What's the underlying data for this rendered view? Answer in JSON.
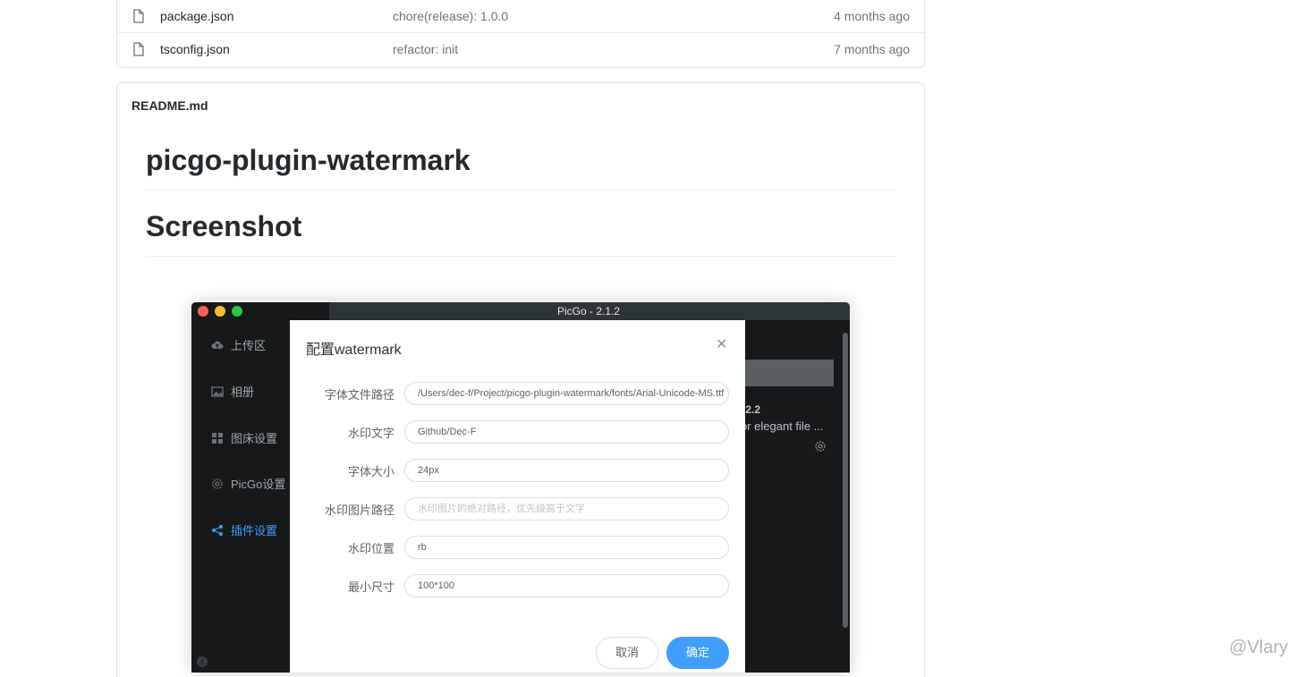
{
  "files": [
    {
      "name": "package.json",
      "message": "chore(release): 1.0.0",
      "age": "4 months ago"
    },
    {
      "name": "tsconfig.json",
      "message": "refactor: init",
      "age": "7 months ago"
    }
  ],
  "readme": {
    "filename": "README.md",
    "h1": "picgo-plugin-watermark",
    "h2": "Screenshot"
  },
  "picgo": {
    "window_title": "PicGo - 2.1.2",
    "sidebar": [
      {
        "label": "上传区",
        "icon": "cloud-upload-icon",
        "active": false
      },
      {
        "label": "相册",
        "icon": "picture-icon",
        "active": false
      },
      {
        "label": "图床设置",
        "icon": "grid-icon",
        "active": false
      },
      {
        "label": "PicGo设置",
        "icon": "gear-icon",
        "active": false
      },
      {
        "label": "插件设置",
        "icon": "share-icon",
        "active": true
      }
    ],
    "background": {
      "plugin_version": ".2.2",
      "plugin_desc": "or elegant file ..."
    },
    "dialog": {
      "title": "配置watermark",
      "fields": [
        {
          "label": "字体文件路径",
          "value": "/Users/dec-f/Project/picgo-plugin-watermark/fonts/Arial-Unicode-MS.ttf",
          "placeholder": ""
        },
        {
          "label": "水印文字",
          "value": "Github/Dec-F",
          "placeholder": ""
        },
        {
          "label": "字体大小",
          "value": "24px",
          "placeholder": ""
        },
        {
          "label": "水印图片路径",
          "value": "",
          "placeholder": "水印图片的绝对路径，优先级高于文字"
        },
        {
          "label": "水印位置",
          "value": "rb",
          "placeholder": ""
        },
        {
          "label": "最小尺寸",
          "value": "100*100",
          "placeholder": ""
        }
      ],
      "cancel_label": "取消",
      "confirm_label": "确定"
    }
  },
  "watermark_text": "@Vlary",
  "colors": {
    "accent": "#409eff",
    "sidebar_bg": "#161819",
    "titlebar": "#2c3437"
  }
}
